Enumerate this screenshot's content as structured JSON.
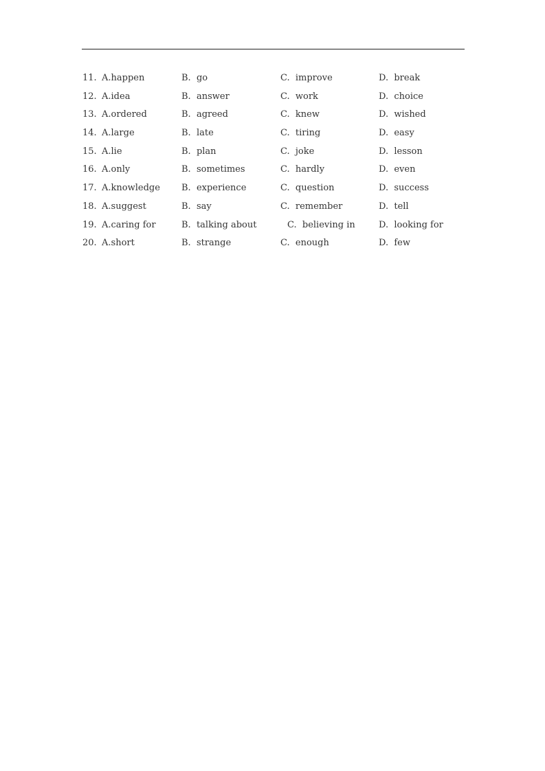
{
  "questions": [
    {
      "num": "11.",
      "a": "A.happen",
      "b": "B.  go",
      "c": "C.  improve",
      "d": "D.  break"
    },
    {
      "num": "12.",
      "a": "A.idea",
      "b": "B.  answer",
      "c": "C.  work",
      "d": "D.  choice"
    },
    {
      "num": "13.",
      "a": "A.ordered",
      "b": "B.  agreed",
      "c": "C.  knew",
      "d": "D.  wished"
    },
    {
      "num": "14.",
      "a": "A.large",
      "b": "B.  late",
      "c": "C.  tiring",
      "d": "D.  easy"
    },
    {
      "num": "15.",
      "a": "A.lie",
      "b": "B.  plan",
      "c": "C.  joke",
      "d": "D.  lesson"
    },
    {
      "num": "16.",
      "a": "A.only",
      "b": "B.  sometimes",
      "c": "C.  hardly",
      "d": "D.  even"
    },
    {
      "num": "17.",
      "a": "A.knowledge",
      "b": "B.  experience",
      "c": "C.  question",
      "d": "D.  success"
    },
    {
      "num": "18.",
      "a": "A.suggest",
      "b": "B.  say",
      "c": "C.  remember",
      "d": "D.  tell"
    },
    {
      "num": "19.",
      "a": "A.caring for",
      "b": "B.  talking about",
      "c": "C.  believing in",
      "d": "D.  looking for"
    },
    {
      "num": "20.",
      "a": "A.short",
      "b": "B.  strange",
      "c": "C.  enough",
      "d": "D.  few"
    }
  ]
}
